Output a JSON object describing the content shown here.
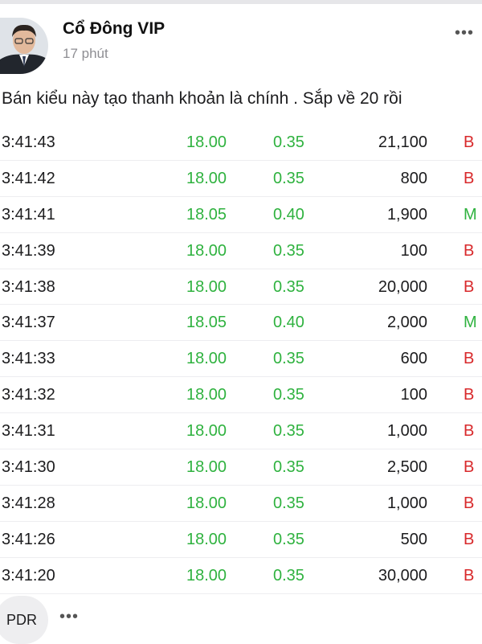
{
  "post": {
    "author": "Cổ Đông VIP",
    "time_ago": "17 phút",
    "text": "Bán kiểu này tạo thanh khoản là chính . Sắp về 20 rồi",
    "more_icon": "•••"
  },
  "trades": [
    {
      "time": "3:41:43",
      "price": "18.00",
      "change": "0.35",
      "volume": "21,100",
      "side": "B"
    },
    {
      "time": "3:41:42",
      "price": "18.00",
      "change": "0.35",
      "volume": "800",
      "side": "B"
    },
    {
      "time": "3:41:41",
      "price": "18.05",
      "change": "0.40",
      "volume": "1,900",
      "side": "M"
    },
    {
      "time": "3:41:39",
      "price": "18.00",
      "change": "0.35",
      "volume": "100",
      "side": "B"
    },
    {
      "time": "3:41:38",
      "price": "18.00",
      "change": "0.35",
      "volume": "20,000",
      "side": "B"
    },
    {
      "time": "3:41:37",
      "price": "18.05",
      "change": "0.40",
      "volume": "2,000",
      "side": "M"
    },
    {
      "time": "3:41:33",
      "price": "18.00",
      "change": "0.35",
      "volume": "600",
      "side": "B"
    },
    {
      "time": "3:41:32",
      "price": "18.00",
      "change": "0.35",
      "volume": "100",
      "side": "B"
    },
    {
      "time": "3:41:31",
      "price": "18.00",
      "change": "0.35",
      "volume": "1,000",
      "side": "B"
    },
    {
      "time": "3:41:30",
      "price": "18.00",
      "change": "0.35",
      "volume": "2,500",
      "side": "B"
    },
    {
      "time": "3:41:28",
      "price": "18.00",
      "change": "0.35",
      "volume": "1,000",
      "side": "B"
    },
    {
      "time": "3:41:26",
      "price": "18.00",
      "change": "0.35",
      "volume": "500",
      "side": "B"
    },
    {
      "time": "3:41:20",
      "price": "18.00",
      "change": "0.35",
      "volume": "30,000",
      "side": "B"
    }
  ],
  "footer": {
    "tag": "PDR",
    "more_icon": "•••"
  },
  "colors": {
    "up_green": "#2fb23f",
    "buy_red": "#d8292b",
    "muted_gray": "#8e8e93"
  }
}
